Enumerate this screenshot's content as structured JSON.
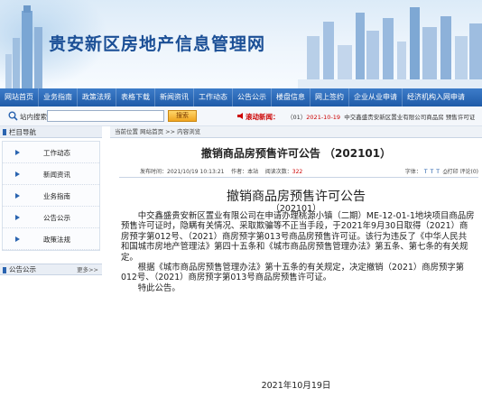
{
  "site": {
    "title": "贵安新区房地产信息管理网"
  },
  "nav": {
    "items": [
      "网站首页",
      "业务指南",
      "政策法规",
      "表格下载",
      "新闻资讯",
      "工作动态",
      "公告公示",
      "楼盘信息",
      "网上签约",
      "企业从业申请",
      "经济机构入网申请"
    ]
  },
  "search": {
    "label": "站内搜索",
    "placeholder": "",
    "button": "搜索",
    "news_label": "滚动新闻：",
    "news_prefix": "（01）",
    "news_date": "2021-10-19",
    "news_text": "中交鑫盛贵安新区置业有限公司商品房  预售许可证"
  },
  "sidebar": {
    "header": "栏目导航",
    "items": [
      "工作动态",
      "新闻资讯",
      "业务指南",
      "公告公示",
      "政策法规"
    ],
    "notice_header": "公告公示",
    "more": "更多>>"
  },
  "main": {
    "breadcrumb": "当前位置 网站首页 >> 内容浏览",
    "article_title": "撤销商品房预售许可公告 （202101）",
    "meta_published_label": "发布时间：",
    "meta_published": "2021/10/19 10:13:21",
    "meta_author_label": "作者：",
    "meta_author": "本站",
    "meta_views_label": "阅读次数：",
    "meta_views": "322",
    "font_label": "字体：",
    "font_t1": "T",
    "font_t2": "T",
    "font_t3": "T",
    "print": "打印",
    "comment": "评论(0)",
    "doc_title": "撤销商品房预售许可公告",
    "doc_no": "（202101）",
    "paragraph1": "中交鑫盛贵安新区置业有限公司在申请办理桃源小镇（二期）ME-12-01-1地块项目商品房预售许可证时，隐瞒有关情况、采取欺骗等不正当手段，于2021年9月30日取得（2021）商房预字第012号、（2021）商房预字第013号商品房预售许可证。该行为违反了《中华人民共和国城市房地产管理法》第四十五条和《城市商品房预售管理办法》第五条、第七条的有关规定。",
    "paragraph2": "根据《城市商品房预售管理办法》第十五条的有关规定，决定撤销（2021）商房预字第012号、（2021）商房预字第013号商品房预售许可证。",
    "paragraph3": "特此公告。",
    "sign_date": "2021年10月19日"
  },
  "colors": {
    "nav": "#1f5ba8",
    "title": "#1b4f96",
    "accent": "#cc0000",
    "button": "#f0a51f"
  }
}
